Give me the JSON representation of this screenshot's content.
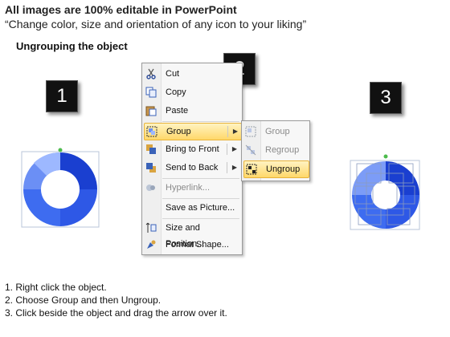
{
  "header": {
    "title": "All images are 100% editable in PowerPoint",
    "subtitle": "“Change color, size and orientation of any icon to your liking”",
    "section_heading": "Ungrouping the object"
  },
  "step_boxes": [
    "1",
    "2",
    "3"
  ],
  "context_menu": {
    "items": [
      {
        "label": "Cut",
        "icon": "scissors-icon",
        "disabled": false
      },
      {
        "label": "Copy",
        "icon": "copy-icon",
        "disabled": false
      },
      {
        "label": "Paste",
        "icon": "paste-icon",
        "disabled": false
      },
      {
        "label": "Group",
        "icon": "group-icon",
        "disabled": false,
        "submenu": true,
        "highlighted": true
      },
      {
        "label": "Bring to Front",
        "icon": "bring-to-front-icon",
        "disabled": false,
        "submenu": true
      },
      {
        "label": "Send to Back",
        "icon": "send-to-back-icon",
        "disabled": false,
        "submenu": true
      },
      {
        "label": "Hyperlink...",
        "icon": "hyperlink-icon",
        "disabled": true
      },
      {
        "label": "Save as Picture...",
        "icon": "",
        "disabled": false
      },
      {
        "label": "Size and Position...",
        "icon": "size-position-icon",
        "disabled": false
      },
      {
        "label": "Format Shape...",
        "icon": "format-shape-icon",
        "disabled": false
      }
    ]
  },
  "submenu": {
    "items": [
      {
        "label": "Group",
        "icon": "group-icon",
        "disabled": true
      },
      {
        "label": "Regroup",
        "icon": "regroup-icon",
        "disabled": true
      },
      {
        "label": "Ungroup",
        "icon": "ungroup-icon",
        "disabled": false,
        "highlighted": true
      }
    ]
  },
  "instructions": [
    "1.  Right click the object.",
    "2.  Choose Group and then Ungroup.",
    "3.  Click beside the object and drag the arrow over it."
  ],
  "colors": {
    "ring_dark": "#1a3fd0",
    "ring_mid": "#3e6cf0",
    "ring_light": "#8fb0ff",
    "highlight": "#ffd86a"
  }
}
